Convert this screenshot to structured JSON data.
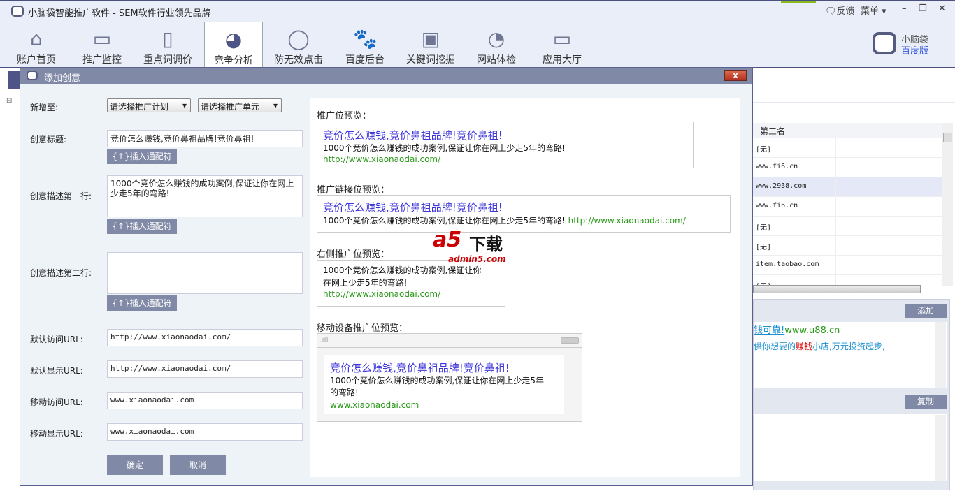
{
  "app": {
    "title": "小脑袋智能推广软件 - SEM软件行业领先品牌",
    "feedback": "反馈",
    "menu": "菜单",
    "brand_line1": "小脑袋",
    "brand_line2": "百度版"
  },
  "toolbar": [
    {
      "label": "账户首页",
      "icon": "home-icon"
    },
    {
      "label": "推广监控",
      "icon": "monitor-icon"
    },
    {
      "label": "重点词调价",
      "icon": "document-icon"
    },
    {
      "label": "竞争分析",
      "icon": "pie-chart-icon",
      "active": true
    },
    {
      "label": "防无效点击",
      "icon": "mouse-icon"
    },
    {
      "label": "百度后台",
      "icon": "baidu-paw-icon"
    },
    {
      "label": "关键词挖掘",
      "icon": "terminal-icon"
    },
    {
      "label": "网站体检",
      "icon": "gauge-icon"
    },
    {
      "label": "应用大厅",
      "icon": "computer-icon"
    }
  ],
  "dialog": {
    "title": "添加创意",
    "close": "x",
    "add_to_label": "新增至:",
    "plan_select": "请选择推广计划",
    "unit_select": "请选择推广单元",
    "title_label": "创意标题:",
    "title_value": "竞价怎么赚钱,竞价鼻祖品牌!竞价鼻祖!",
    "desc1_label": "创意描述第一行:",
    "desc1_value": "1000个竞价怎么赚钱的成功案例,保证让你在网上少走5年的弯路!",
    "desc2_label": "创意描述第二行:",
    "desc2_value": "",
    "insert_wildcard": "{↑}插入通配符",
    "visit_url_label": "默认访问URL:",
    "visit_url": "http://www.xiaonaodai.com/",
    "display_url_label": "默认显示URL:",
    "display_url": "http://www.xiaonaodai.com/",
    "mobile_visit_label": "移动访问URL:",
    "mobile_visit": "www.xiaonaodai.com",
    "mobile_display_label": "移动显示URL:",
    "mobile_display": "www.xiaonaodai.com",
    "ok": "确定",
    "cancel": "取消"
  },
  "preview": {
    "promo_heading": "推广位预览：",
    "link_heading": "推广链接位预览：",
    "right_heading": "右侧推广位预览：",
    "mobile_heading": "移动设备推广位预览：",
    "ad_title": "竞价怎么赚钱,竞价鼻祖品牌!竞价鼻祖!",
    "ad_desc": "1000个竞价怎么赚钱的成功案例,保证让你在网上少走5年的弯路!",
    "right_desc1": "1000个竞价怎么赚钱的成功案例,保证让你",
    "right_desc2": "在网上少走5年的弯路!",
    "mobile_desc1": "1000个竞价怎么赚钱的成功案例,保证让你在网上少走5年",
    "mobile_desc2": "的弯路!",
    "ad_url": "http://www.xiaonaodai.com/",
    "mobile_url": "www.xiaonaodai.com"
  },
  "watermark": {
    "brand": "a5下载",
    "site": "admin5.com"
  },
  "background": {
    "tree_toggle": "⊟",
    "column_header": "第三名",
    "rows": [
      "[无]",
      "www.fi6.cn",
      "www.2938.com",
      "www.fi6.cn",
      "[无]",
      "[无]",
      "item.taobao.com",
      "[无]"
    ],
    "add_button": "添加",
    "copy_button": "复制",
    "ad_line1_link": "钱可靠!",
    "ad_line1_url": "www.u88.cn",
    "ad_line2_a": "供你想要的",
    "ad_line2_hl": "赚钱",
    "ad_line2_b": "小店,万元投资起步,"
  }
}
